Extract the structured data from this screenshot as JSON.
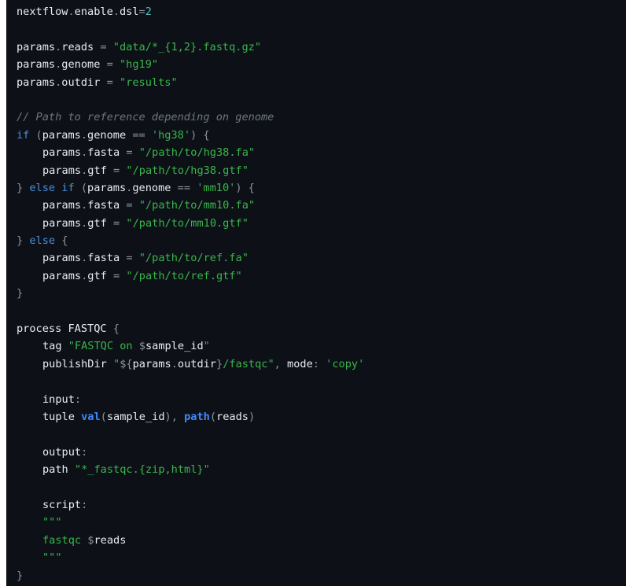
{
  "editor": {
    "language": "nextflow",
    "background": "#0d1117",
    "colors": {
      "plain": "#e6edf3",
      "punct": "#8b949e",
      "string": "#39b54a",
      "number": "#56b6c2",
      "comment": "#6e7681",
      "keyword": "#4c8edb",
      "builtin": "#3d8bfd"
    },
    "lines": [
      [
        [
          "plain",
          "nextflow"
        ],
        [
          "punct",
          "."
        ],
        [
          "plain",
          "enable"
        ],
        [
          "punct",
          "."
        ],
        [
          "plain",
          "dsl"
        ],
        [
          "op",
          "="
        ],
        [
          "num",
          "2"
        ]
      ],
      [],
      [
        [
          "plain",
          "params"
        ],
        [
          "punct",
          "."
        ],
        [
          "plain",
          "reads"
        ],
        [
          "op",
          " = "
        ],
        [
          "str",
          "\"data/*_{1,2}.fastq.gz\""
        ]
      ],
      [
        [
          "plain",
          "params"
        ],
        [
          "punct",
          "."
        ],
        [
          "plain",
          "genome"
        ],
        [
          "op",
          " = "
        ],
        [
          "str",
          "\"hg19\""
        ]
      ],
      [
        [
          "plain",
          "params"
        ],
        [
          "punct",
          "."
        ],
        [
          "plain",
          "outdir"
        ],
        [
          "op",
          " = "
        ],
        [
          "str",
          "\"results\""
        ]
      ],
      [],
      [
        [
          "com",
          "// Path to reference depending on genome"
        ]
      ],
      [
        [
          "kw",
          "if"
        ],
        [
          "punct",
          " ("
        ],
        [
          "plain",
          "params"
        ],
        [
          "punct",
          "."
        ],
        [
          "plain",
          "genome"
        ],
        [
          "op",
          " == "
        ],
        [
          "str",
          "'hg38'"
        ],
        [
          "punct",
          ") {"
        ]
      ],
      [
        [
          "ind",
          ""
        ],
        [
          "plain",
          "params"
        ],
        [
          "punct",
          "."
        ],
        [
          "plain",
          "fasta"
        ],
        [
          "op",
          " = "
        ],
        [
          "str",
          "\"/path/to/hg38.fa\""
        ]
      ],
      [
        [
          "ind",
          ""
        ],
        [
          "plain",
          "params"
        ],
        [
          "punct",
          "."
        ],
        [
          "plain",
          "gtf"
        ],
        [
          "op",
          " = "
        ],
        [
          "str",
          "\"/path/to/hg38.gtf\""
        ]
      ],
      [
        [
          "punct",
          "} "
        ],
        [
          "kw",
          "else if"
        ],
        [
          "punct",
          " ("
        ],
        [
          "plain",
          "params"
        ],
        [
          "punct",
          "."
        ],
        [
          "plain",
          "genome"
        ],
        [
          "op",
          " == "
        ],
        [
          "str",
          "'mm10'"
        ],
        [
          "punct",
          ") {"
        ]
      ],
      [
        [
          "ind",
          ""
        ],
        [
          "plain",
          "params"
        ],
        [
          "punct",
          "."
        ],
        [
          "plain",
          "fasta"
        ],
        [
          "op",
          " = "
        ],
        [
          "str",
          "\"/path/to/mm10.fa\""
        ]
      ],
      [
        [
          "ind",
          ""
        ],
        [
          "plain",
          "params"
        ],
        [
          "punct",
          "."
        ],
        [
          "plain",
          "gtf"
        ],
        [
          "op",
          " = "
        ],
        [
          "str",
          "\"/path/to/mm10.gtf\""
        ]
      ],
      [
        [
          "punct",
          "} "
        ],
        [
          "kw",
          "else"
        ],
        [
          "punct",
          " {"
        ]
      ],
      [
        [
          "ind",
          ""
        ],
        [
          "plain",
          "params"
        ],
        [
          "punct",
          "."
        ],
        [
          "plain",
          "fasta"
        ],
        [
          "op",
          " = "
        ],
        [
          "str",
          "\"/path/to/ref.fa\""
        ]
      ],
      [
        [
          "ind",
          ""
        ],
        [
          "plain",
          "params"
        ],
        [
          "punct",
          "."
        ],
        [
          "plain",
          "gtf"
        ],
        [
          "op",
          " = "
        ],
        [
          "str",
          "\"/path/to/ref.gtf\""
        ]
      ],
      [
        [
          "punct",
          "}"
        ]
      ],
      [],
      [
        [
          "plain",
          "process FASTQC "
        ],
        [
          "punct",
          "{"
        ]
      ],
      [
        [
          "ind",
          ""
        ],
        [
          "plain",
          "tag "
        ],
        [
          "str",
          "\"FASTQC on "
        ],
        [
          "punct",
          "$"
        ],
        [
          "plain",
          "sample_id"
        ],
        [
          "str",
          "\""
        ]
      ],
      [
        [
          "ind",
          ""
        ],
        [
          "plain",
          "publishDir "
        ],
        [
          "str",
          "\""
        ],
        [
          "punct",
          "${"
        ],
        [
          "plain",
          "params"
        ],
        [
          "punct",
          "."
        ],
        [
          "plain",
          "outdir"
        ],
        [
          "punct",
          "}"
        ],
        [
          "str",
          "/fastqc\""
        ],
        [
          "punct",
          ", "
        ],
        [
          "plain",
          "mode"
        ],
        [
          "punct",
          ": "
        ],
        [
          "str",
          "'copy'"
        ]
      ],
      [],
      [
        [
          "ind",
          ""
        ],
        [
          "plain",
          "input"
        ],
        [
          "punct",
          ":"
        ]
      ],
      [
        [
          "ind",
          ""
        ],
        [
          "plain",
          "tuple "
        ],
        [
          "fn",
          "val"
        ],
        [
          "punct",
          "("
        ],
        [
          "plain",
          "sample_id"
        ],
        [
          "punct",
          "), "
        ],
        [
          "fn",
          "path"
        ],
        [
          "punct",
          "("
        ],
        [
          "plain",
          "reads"
        ],
        [
          "punct",
          ")"
        ]
      ],
      [],
      [
        [
          "ind",
          ""
        ],
        [
          "plain",
          "output"
        ],
        [
          "punct",
          ":"
        ]
      ],
      [
        [
          "ind",
          ""
        ],
        [
          "plain",
          "path "
        ],
        [
          "str",
          "\"*_fastqc.{zip,html}\""
        ]
      ],
      [],
      [
        [
          "ind",
          ""
        ],
        [
          "plain",
          "script"
        ],
        [
          "punct",
          ":"
        ]
      ],
      [
        [
          "ind",
          ""
        ],
        [
          "str",
          "\"\"\""
        ]
      ],
      [
        [
          "ind",
          ""
        ],
        [
          "str",
          "fastqc "
        ],
        [
          "punct",
          "$"
        ],
        [
          "plain",
          "reads"
        ]
      ],
      [
        [
          "ind",
          ""
        ],
        [
          "str",
          "\"\"\""
        ]
      ],
      [
        [
          "punct",
          "}"
        ]
      ]
    ]
  }
}
